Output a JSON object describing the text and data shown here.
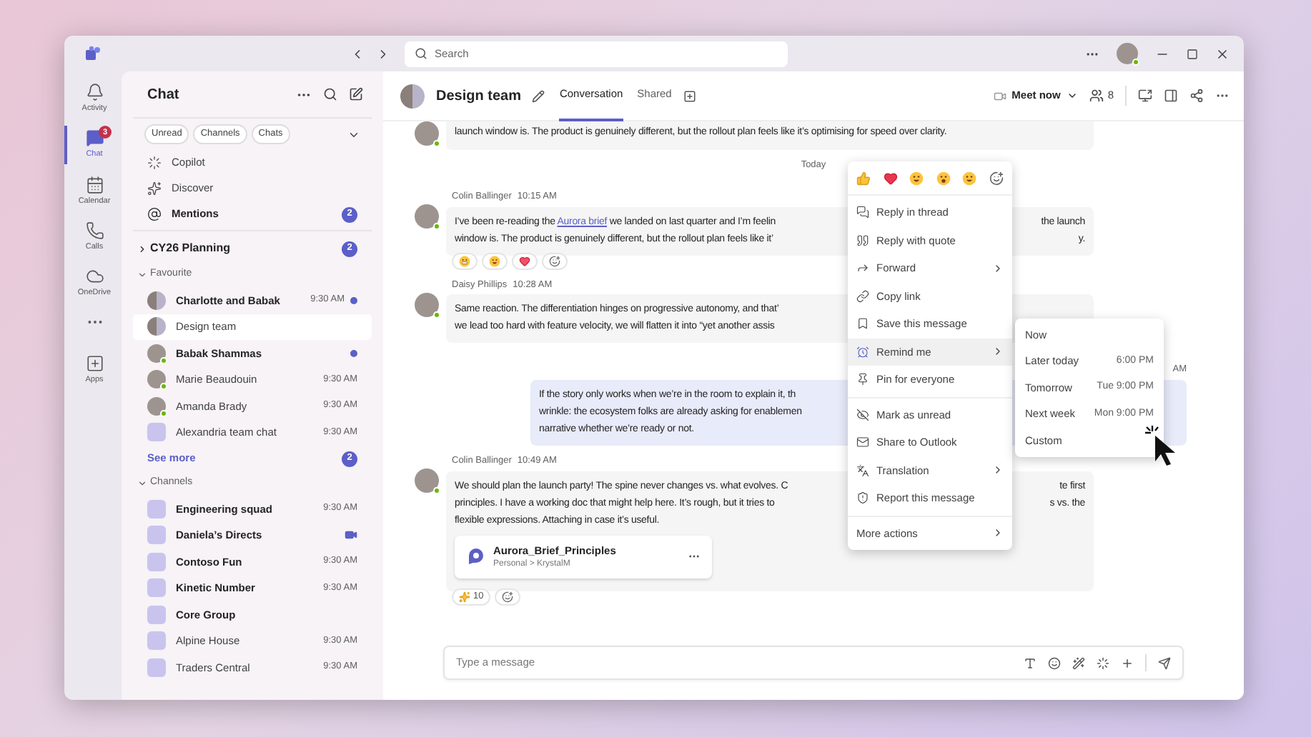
{
  "title_bar": {
    "search": {
      "placeholder": "Search"
    }
  },
  "rail": [
    {
      "kind": "activity",
      "label": "Activity",
      "selected": false
    },
    {
      "kind": "chat",
      "label": "Chat",
      "selected": true,
      "badge": "3"
    },
    {
      "kind": "calendar",
      "label": "Calendar",
      "selected": false
    },
    {
      "kind": "calls",
      "label": "Calls",
      "selected": false
    },
    {
      "kind": "onedrive",
      "label": "OneDrive",
      "selected": false
    },
    {
      "kind": "more",
      "selected": false
    },
    {
      "kind": "apps",
      "label": "Apps",
      "selected": false
    }
  ],
  "chat_list": {
    "title": "Chat",
    "filters": [
      "Unread",
      "Channels",
      "Chats"
    ],
    "quick": [
      {
        "kind": "copilot",
        "label": "Copilot",
        "unread": false
      },
      {
        "kind": "discover",
        "label": "Discover",
        "unread": false
      },
      {
        "kind": "mentions",
        "label": "Mentions",
        "unread": true,
        "badge": "2"
      }
    ],
    "groups": [
      {
        "kind": "pinned",
        "label": "CY26 Planning",
        "expanded": false,
        "badge": "2"
      },
      {
        "kind": "section",
        "label": "Favourite",
        "expanded": true,
        "items": [
          {
            "name": "Charlotte and Babak",
            "kind": "group",
            "unread": true,
            "selected": false,
            "time": "9:30 AM",
            "dot": true
          },
          {
            "name": "Design team",
            "kind": "group",
            "unread": false,
            "selected": true
          },
          {
            "name": "Babak Shammas",
            "kind": "person",
            "online": true,
            "unread": true,
            "selected": false,
            "dot": true
          },
          {
            "name": "Marie Beaudouin",
            "kind": "person",
            "online": true,
            "unread": false,
            "selected": false,
            "time": "9:30 AM"
          },
          {
            "name": "Amanda Brady",
            "kind": "person",
            "online": true,
            "unread": false,
            "selected": false,
            "time": "9:30 AM"
          },
          {
            "name": "Alexandria team chat",
            "kind": "channel",
            "unread": false,
            "selected": false,
            "time": "9:30 AM"
          }
        ],
        "see_more": {
          "label": "See more",
          "badge": "2"
        }
      },
      {
        "kind": "section",
        "label": "Channels",
        "expanded": true,
        "items": [
          {
            "name": "Engineering squad",
            "kind": "channel",
            "unread": true,
            "selected": false,
            "time": "9:30 AM"
          },
          {
            "name": "Daniela’s Directs",
            "kind": "channel",
            "unread": true,
            "selected": false,
            "meeting": true
          },
          {
            "name": "Contoso Fun",
            "kind": "channel",
            "unread": true,
            "selected": false,
            "time": "9:30 AM"
          },
          {
            "name": "Kinetic Number",
            "kind": "channel",
            "unread": true,
            "selected": false,
            "time": "9:30 AM"
          },
          {
            "name": "Core Group",
            "kind": "channel",
            "unread": true,
            "selected": false
          },
          {
            "name": "Alpine House",
            "kind": "channel",
            "unread": false,
            "selected": false,
            "time": "9:30 AM"
          },
          {
            "name": "Traders Central",
            "kind": "channel",
            "unread": false,
            "selected": false,
            "time": "9:30 AM"
          }
        ]
      }
    ]
  },
  "header": {
    "title": "Design team",
    "tabs": [
      {
        "label": "Conversation",
        "selected": true
      },
      {
        "label": "Shared",
        "selected": false
      }
    ],
    "meet": "Meet now",
    "participants": "8"
  },
  "messages": [
    {
      "kind": "message",
      "self": false,
      "continued": true,
      "lines": [
        {
          "parts": [
            {
              "text": "launch window is. The product is genuinely different, but the rollout plan feels like it’s optimising for speed over clarity."
            }
          ]
        }
      ]
    },
    {
      "kind": "divider",
      "label": "Today"
    },
    {
      "kind": "message",
      "self": false,
      "author": "Colin Ballinger",
      "time": "10:15 AM",
      "lines": [
        {
          "parts": [
            {
              "text": "I’ve been re-reading the "
            },
            {
              "text": "Aurora brief",
              "kind": "link"
            },
            {
              "text": " we landed on last quarter and I’m feelin"
            }
          ],
          "right": "the launch"
        },
        {
          "parts": [
            {
              "text": "window is. The product is genuinely different, but the rollout plan feels like it’"
            }
          ],
          "right": "y."
        }
      ],
      "reactions": [
        {
          "kind": "grimace"
        },
        {
          "kind": "laugh"
        },
        {
          "kind": "hearts"
        },
        {
          "kind": "add"
        }
      ]
    },
    {
      "kind": "message",
      "self": false,
      "author": "Daisy Phillips",
      "time": "10:28 AM",
      "lines": [
        {
          "parts": [
            {
              "text": "Same reaction. The differentiation hinges on progressive autonomy, and that’"
            }
          ]
        },
        {
          "parts": [
            {
              "text": "we lead too hard with feature velocity, we will flatten it into “yet another assis"
            }
          ]
        }
      ]
    },
    {
      "kind": "message",
      "self": true,
      "time": "AM",
      "lines": [
        {
          "parts": [
            {
              "text": "If the story only works when we’re in the room to explain it, th"
            }
          ]
        },
        {
          "parts": [
            {
              "text": "wrinkle: the ecosystem folks are already asking for enablemen"
            }
          ]
        },
        {
          "parts": [
            {
              "text": "narrative whether we’re ready or not."
            }
          ]
        }
      ]
    },
    {
      "kind": "message",
      "self": false,
      "author": "Colin Ballinger",
      "time": "10:49 AM",
      "lines": [
        {
          "parts": [
            {
              "text": "We should plan the launch party! The spine never changes vs. what evolves. C"
            }
          ],
          "right": "te first"
        },
        {
          "parts": [
            {
              "text": "principles. I have a working doc that might help here. It’s rough, but it tries to"
            }
          ],
          "right": "s vs. the"
        },
        {
          "parts": [
            {
              "text": "flexible expressions. Attaching in case it’s useful."
            }
          ]
        }
      ],
      "attachment": {
        "name": "Aurora_Brief_Principles",
        "path": "Personal > KrystalM"
      },
      "reactions": [
        {
          "kind": "sparkle",
          "count": "10"
        },
        {
          "kind": "add"
        }
      ]
    }
  ],
  "compose": {
    "placeholder": "Type a message"
  },
  "context_menu": {
    "reactions": [
      {
        "kind": "like"
      },
      {
        "kind": "heart"
      },
      {
        "kind": "laugh"
      },
      {
        "kind": "surprised"
      },
      {
        "kind": "grin"
      },
      {
        "kind": "add"
      }
    ],
    "groups": [
      [
        {
          "kind": "reply",
          "label": "Reply in thread",
          "submenu": false,
          "selected": false
        },
        {
          "kind": "quote",
          "label": "Reply with quote",
          "submenu": false,
          "selected": false
        },
        {
          "kind": "forward",
          "label": "Forward",
          "submenu": true,
          "selected": false
        },
        {
          "kind": "link",
          "label": "Copy link",
          "submenu": false,
          "selected": false
        },
        {
          "kind": "save",
          "label": "Save this message",
          "submenu": false,
          "selected": false
        },
        {
          "kind": "remind",
          "label": "Remind me",
          "submenu": true,
          "selected": true
        },
        {
          "kind": "pin",
          "label": "Pin for everyone",
          "submenu": false,
          "selected": false
        }
      ],
      [
        {
          "kind": "unread",
          "label": "Mark as unread",
          "submenu": false,
          "selected": false
        },
        {
          "kind": "mail",
          "label": "Share to Outlook",
          "submenu": false,
          "selected": false
        },
        {
          "kind": "translate",
          "label": "Translation",
          "submenu": true,
          "selected": false
        },
        {
          "kind": "report",
          "label": "Report this message",
          "submenu": false,
          "selected": false
        }
      ],
      [
        {
          "kind": "none",
          "label": "More actions",
          "submenu": true,
          "selected": false
        }
      ]
    ]
  },
  "remind_submenu": [
    {
      "label": "Now"
    },
    {
      "label": "Later today",
      "time": "6:00 PM"
    },
    {
      "label": "Tomorrow",
      "time": "Tue 9:00 PM"
    },
    {
      "label": "Next week",
      "time": "Mon 9:00 PM"
    },
    {
      "label": "Custom"
    }
  ]
}
